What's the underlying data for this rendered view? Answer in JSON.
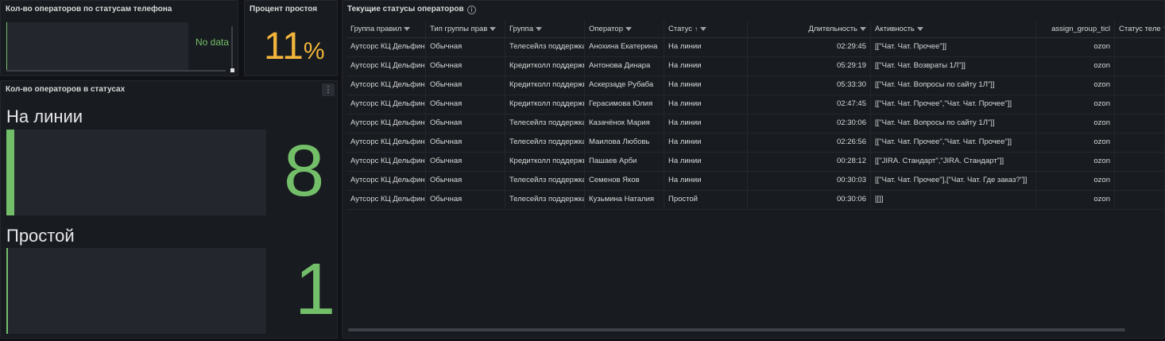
{
  "phone_panel": {
    "title": "Кол-во операторов по статусам телефона",
    "no_data": "No data"
  },
  "idle_panel": {
    "title": "Процент простоя",
    "value": "11",
    "unit": "%",
    "color": "#f2b53c"
  },
  "counts_panel": {
    "title": "Кол-во операторов в статусах",
    "menu_icon": "vertical-dots-icon",
    "stats": [
      {
        "label": "На линии",
        "value": "8"
      },
      {
        "label": "Простой",
        "value": "1"
      }
    ],
    "color": "#73bf69"
  },
  "table_panel": {
    "title": "Текущие статусы операторов",
    "info_icon": "info-icon",
    "columns": [
      "Группа правил",
      "Тип группы прав",
      "Группа",
      "Оператор",
      "Статус",
      "Длительность",
      "Активность",
      "assign_group_ticl",
      "Статус теле"
    ],
    "rows": [
      [
        "Аутсорс КЦ Дельфин",
        "Обычная",
        "Телесейлз поддержка",
        "Анохина Екатерина",
        "На линии",
        "02:29:45",
        "[[\"Чат. Чат. Прочее\"]]",
        "ozon",
        ""
      ],
      [
        "Аутсорс КЦ Дельфин",
        "Обычная",
        "Кредитколл поддержка",
        "Антонова Динара",
        "На линии",
        "05:29:19",
        "[[\"Чат. Чат. Возвраты 1Л\"]]",
        "ozon",
        ""
      ],
      [
        "Аутсорс КЦ Дельфин",
        "Обычная",
        "Кредитколл поддержка",
        "Аскерзаде Рубаба",
        "На линии",
        "05:33:30",
        "[[\"Чат. Чат. Вопросы по сайту 1Л\"]]",
        "ozon",
        ""
      ],
      [
        "Аутсорс КЦ Дельфин",
        "Обычная",
        "Кредитколл поддержка",
        "Герасимова Юлия",
        "На линии",
        "02:47:45",
        "[[\"Чат. Чат. Прочее\",\"Чат. Чат. Прочее\"]]",
        "ozon",
        ""
      ],
      [
        "Аутсорс КЦ Дельфин",
        "Обычная",
        "Телесейлз поддержка",
        "Казачёнок Мария",
        "На линии",
        "02:30:06",
        "[[\"Чат. Чат. Вопросы по сайту 1Л\"]]",
        "ozon",
        ""
      ],
      [
        "Аутсорс КЦ Дельфин",
        "Обычная",
        "Телесейлз поддержка",
        "Маилова Любовь",
        "На линии",
        "02:26:56",
        "[[\"Чат. Чат. Прочее\",\"Чат. Чат. Прочее\"]]",
        "ozon",
        ""
      ],
      [
        "Аутсорс КЦ Дельфин",
        "Обычная",
        "Кредитколл поддержка",
        "Пашаев Арби",
        "На линии",
        "00:28:12",
        "[[\"JIRA. Стандарт\",\"JIRA. Стандарт\"]]",
        "ozon",
        ""
      ],
      [
        "Аутсорс КЦ Дельфин",
        "Обычная",
        "Телесейлз поддержка",
        "Семенов Яков",
        "На линии",
        "00:30:03",
        "[[\"Чат. Чат. Прочее\"],[\"Чат. Чат. Где заказ?\"]]",
        "ozon",
        ""
      ],
      [
        "Аутсорс КЦ Дельфин",
        "Обычная",
        "Телесейлз поддержка",
        "Кузьмина Наталия",
        "Простой",
        "00:30:06",
        "[[]]",
        "ozon",
        ""
      ]
    ]
  }
}
